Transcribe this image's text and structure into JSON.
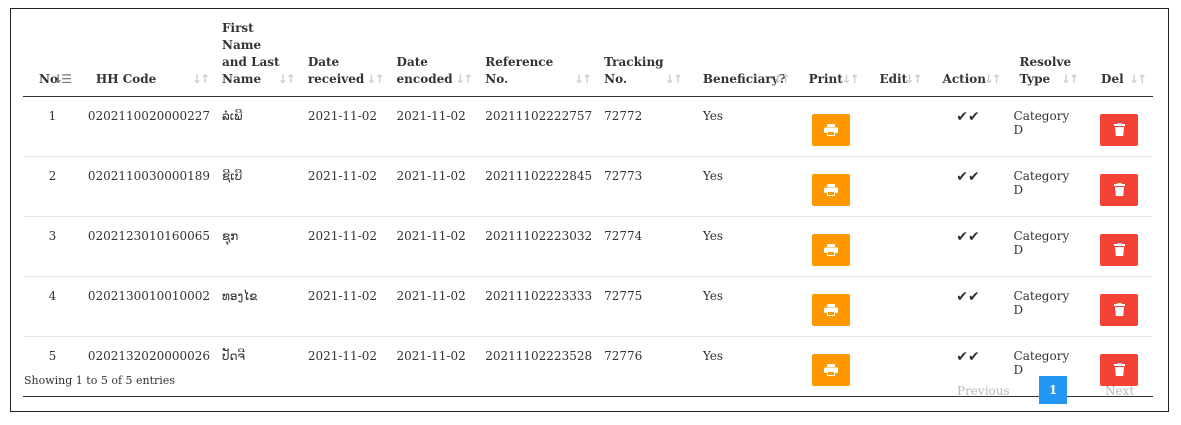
{
  "table": {
    "headers": {
      "no": "No",
      "hh_code": "HH Code",
      "name_l1": "First",
      "name_l2": "Name",
      "name_l3": "and Last",
      "name_l4": "Name",
      "date_received_l1": "Date",
      "date_received_l2": "received",
      "date_encoded_l1": "Date",
      "date_encoded_l2": "encoded",
      "reference_l1": "Reference",
      "reference_l2": "No.",
      "tracking_l1": "Tracking",
      "tracking_l2": "No.",
      "beneficiary": "Beneficiary?",
      "print": "Print",
      "edit": "Edit",
      "action": "Action",
      "resolve_l1": "Resolve",
      "resolve_l2": "Type",
      "del": "Del"
    },
    "sort_icon": "sort-arrows-icon",
    "rows": [
      {
        "no": "1",
        "hh_code": "0202110020000227",
        "name": "ລໍເພີ",
        "date_received": "2021-11-02",
        "date_encoded": "2021-11-02",
        "reference": "20211102222757",
        "tracking": "72772",
        "beneficiary": "Yes",
        "resolve": "Category D"
      },
      {
        "no": "2",
        "hh_code": "0202110030000189",
        "name": "ຊີເບີ",
        "date_received": "2021-11-02",
        "date_encoded": "2021-11-02",
        "reference": "20211102222845",
        "tracking": "72773",
        "beneficiary": "Yes",
        "resolve": "Category D"
      },
      {
        "no": "3",
        "hh_code": "0202123010160065",
        "name": "ຊຸກ",
        "date_received": "2021-11-02",
        "date_encoded": "2021-11-02",
        "reference": "20211102223032",
        "tracking": "72774",
        "beneficiary": "Yes",
        "resolve": "Category D"
      },
      {
        "no": "4",
        "hh_code": "0202130010010002",
        "name": "ທອງໄຂ",
        "date_received": "2021-11-02",
        "date_encoded": "2021-11-02",
        "reference": "20211102223333",
        "tracking": "72775",
        "beneficiary": "Yes",
        "resolve": "Category D"
      },
      {
        "no": "5",
        "hh_code": "0202132020000026",
        "name": "ປັດຈີ",
        "date_received": "2021-11-02",
        "date_encoded": "2021-11-02",
        "reference": "20211102223528",
        "tracking": "72776",
        "beneficiary": "Yes",
        "resolve": "Category D"
      }
    ],
    "action_glyph": "✔✔"
  },
  "footer": {
    "info": "Showing 1 to 5 of 5 entries",
    "previous": "Previous",
    "page": "1",
    "next": "Next"
  },
  "colors": {
    "print_button": "#ff9800",
    "delete_button": "#f44336",
    "active_page": "#2196f3"
  }
}
